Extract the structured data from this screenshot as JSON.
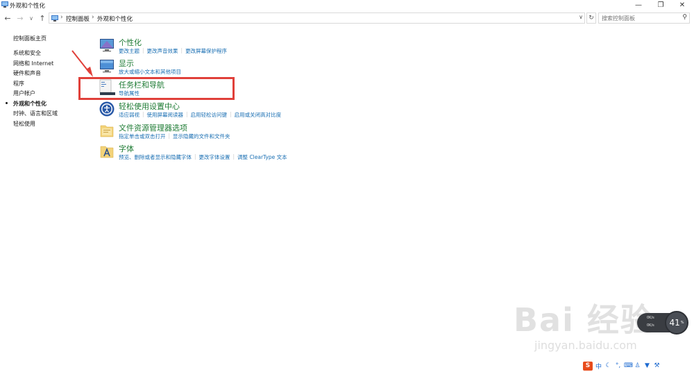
{
  "window": {
    "title": "外观和个性化"
  },
  "address": {
    "crumbs": [
      "控制面板",
      "外观和个性化"
    ]
  },
  "search": {
    "placeholder": "搜索控制面板"
  },
  "sidebar": {
    "items": [
      {
        "label": "控制面板主页"
      },
      {
        "label": "系统和安全"
      },
      {
        "label": "网络和 Internet"
      },
      {
        "label": "硬件和声音"
      },
      {
        "label": "程序"
      },
      {
        "label": "用户帐户"
      },
      {
        "label": "外观和个性化",
        "active": true
      },
      {
        "label": "时钟、语言和区域"
      },
      {
        "label": "轻松使用"
      }
    ]
  },
  "categories": [
    {
      "title": "个性化",
      "icon": "personalization-icon",
      "links": [
        "更改主题",
        "更改声音效果",
        "更改屏幕保护程序"
      ]
    },
    {
      "title": "显示",
      "icon": "display-icon",
      "links": [
        "放大或缩小文本和其他项目"
      ]
    },
    {
      "title": "任务栏和导航",
      "icon": "taskbar-icon",
      "links": [
        "导航属性"
      ]
    },
    {
      "title": "轻松使用设置中心",
      "icon": "ease-of-access-icon",
      "links": [
        "适应弱视",
        "使用屏幕阅读器",
        "启用轻松访问键",
        "启用或关闭高对比度"
      ]
    },
    {
      "title": "文件资源管理器选项",
      "icon": "folder-options-icon",
      "links": [
        "指定单击或双击打开",
        "显示隐藏的文件和文件夹"
      ]
    },
    {
      "title": "字体",
      "icon": "fonts-icon",
      "links": [
        "预览、删除或者显示和隐藏字体",
        "更改字体设置",
        "调整 ClearType 文本"
      ]
    }
  ],
  "watermark": {
    "main": "Bai 经验",
    "sub": "jingyan.baidu.com"
  },
  "speed_widget": {
    "up": "0K/s",
    "down": "0K/s",
    "percent": "41",
    "percent_unit": "%"
  },
  "ime": {
    "logo": "S",
    "mode": "中"
  },
  "colors": {
    "category_title": "#1e7b34",
    "link": "#1a6fb3",
    "highlight": "#e0403a"
  }
}
